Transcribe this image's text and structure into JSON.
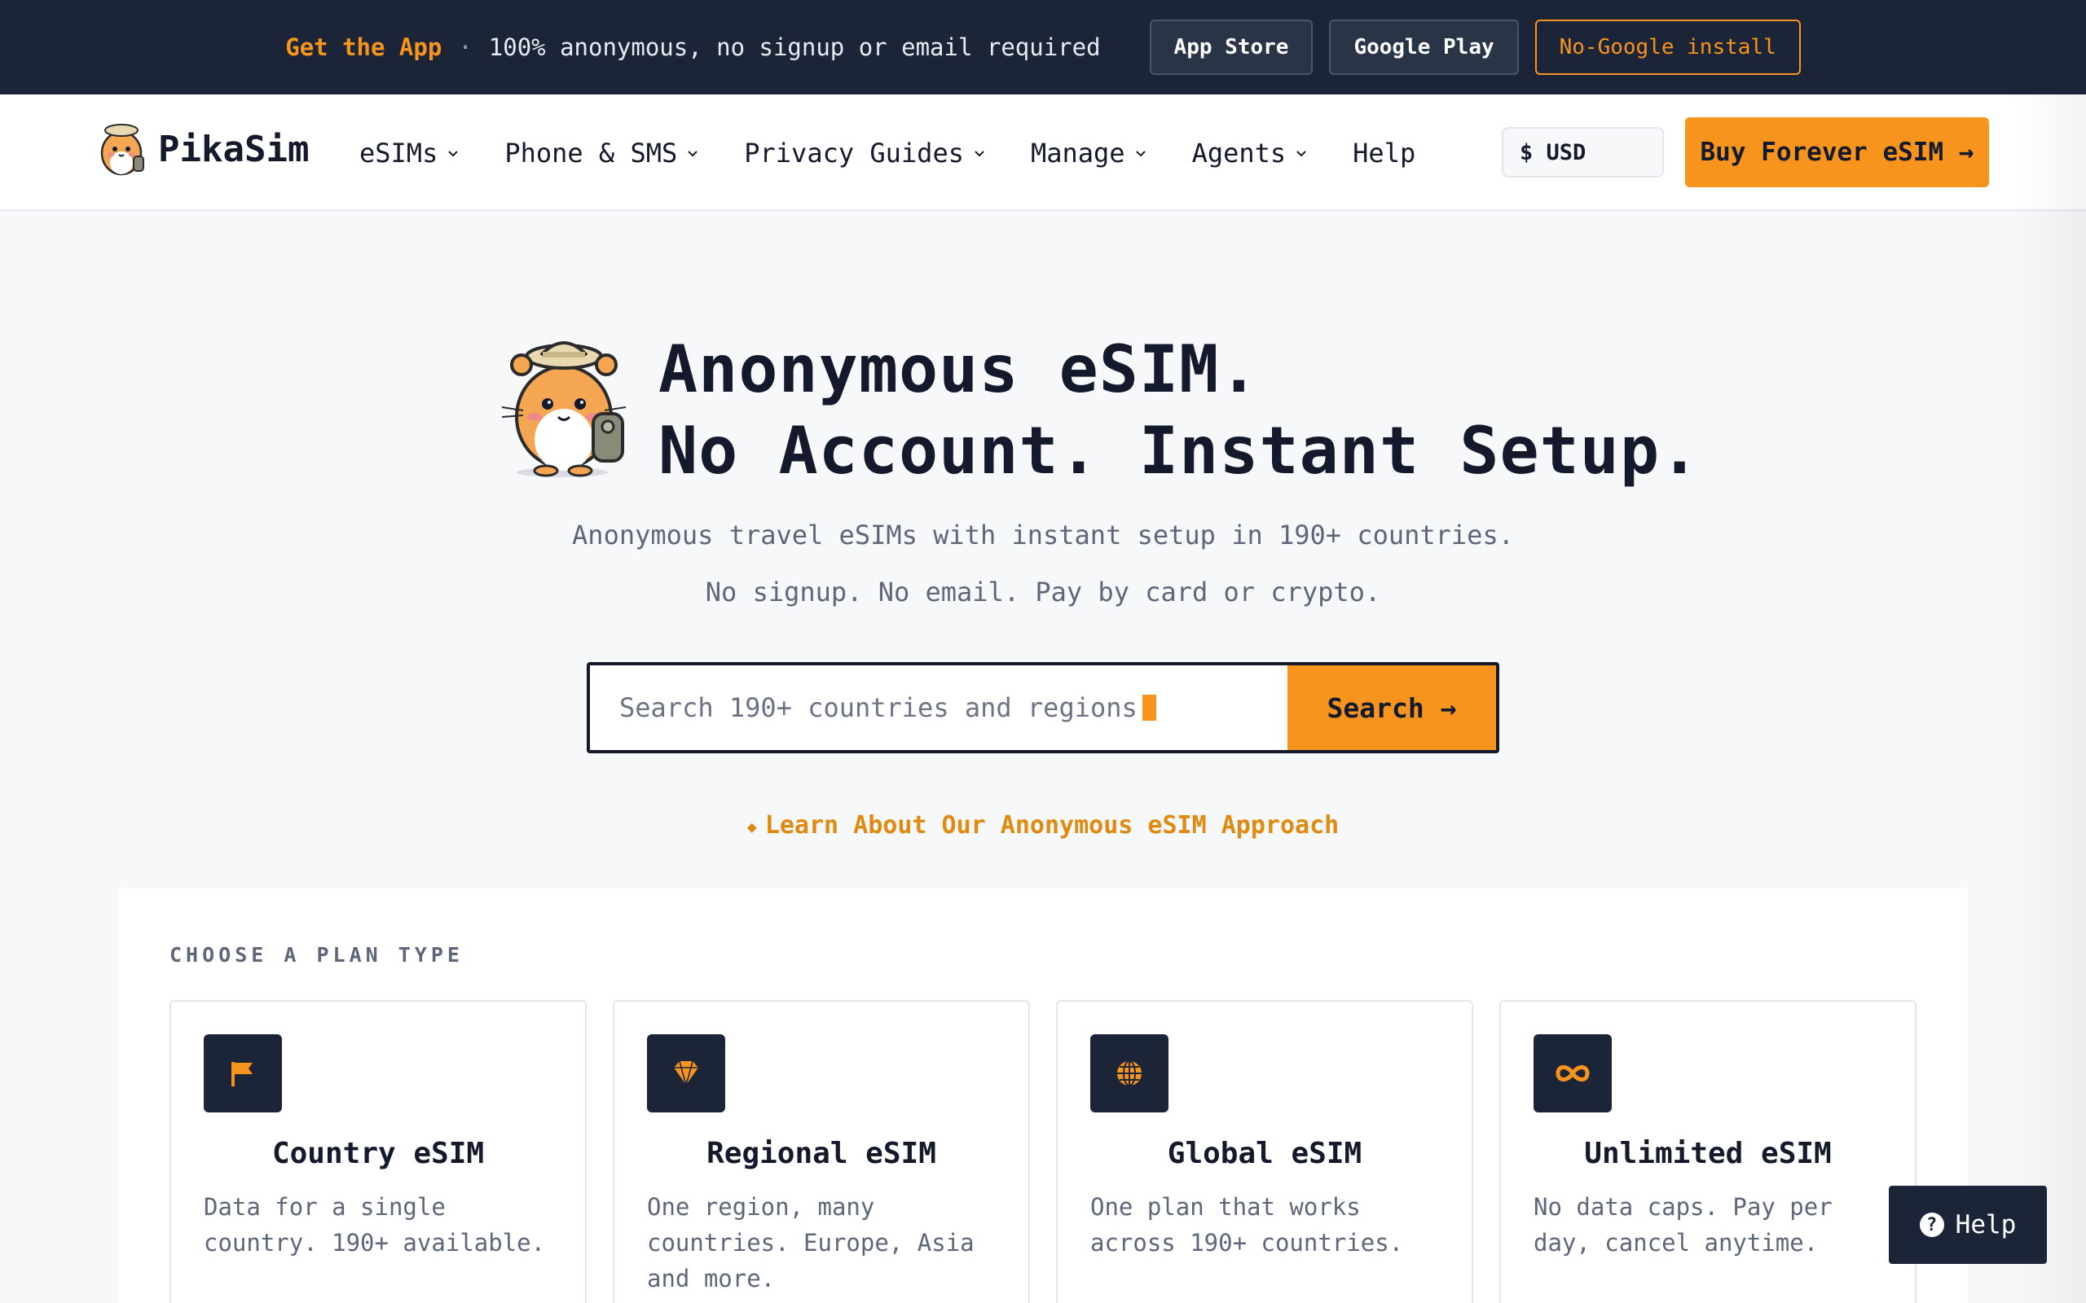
{
  "promo": {
    "get_app": "Get the App",
    "separator": "·",
    "tagline": "100% anonymous, no signup or email required",
    "buttons": [
      "App Store",
      "Google Play",
      "No-Google install"
    ]
  },
  "nav": {
    "brand": "PikaSim",
    "items": [
      {
        "label": "eSIMs",
        "dropdown": true
      },
      {
        "label": "Phone & SMS",
        "dropdown": true
      },
      {
        "label": "Privacy Guides",
        "dropdown": true
      },
      {
        "label": "Manage",
        "dropdown": true
      },
      {
        "label": "Agents",
        "dropdown": true
      },
      {
        "label": "Help",
        "dropdown": false
      }
    ],
    "currency": "$ USD",
    "cta": "Buy Forever eSIM →"
  },
  "hero": {
    "title_line1": "Anonymous eSIM.",
    "title_line2": "No Account. Instant Setup.",
    "subtitle_line1": "Anonymous travel eSIMs with instant setup in 190+ countries.",
    "subtitle_line2": "No signup. No email. Pay by card or crypto.",
    "search_placeholder": "Search 190+ countries and regions",
    "search_button": "Search →",
    "learn_link": "Learn About Our Anonymous eSIM Approach",
    "learn_marker": "◆"
  },
  "plans": {
    "label": "CHOOSE A PLAN TYPE",
    "cards": [
      {
        "icon": "flag-icon",
        "title": "Country eSIM",
        "desc": "Data for a single country. 190+ available."
      },
      {
        "icon": "gem-icon",
        "title": "Regional eSIM",
        "desc": "One region, many countries. Europe, Asia and more."
      },
      {
        "icon": "globe-icon",
        "title": "Global eSIM",
        "desc": "One plan that works across 190+ countries."
      },
      {
        "icon": "infinity-icon",
        "title": "Unlimited eSIM",
        "desc": "No data caps. Pay per day, cancel anytime."
      }
    ]
  },
  "help_float": {
    "label": "Help",
    "glyph": "?"
  },
  "colors": {
    "accent": "#f7941d",
    "dark": "#1c2538",
    "text": "#141a2c",
    "muted": "#5e6779"
  }
}
